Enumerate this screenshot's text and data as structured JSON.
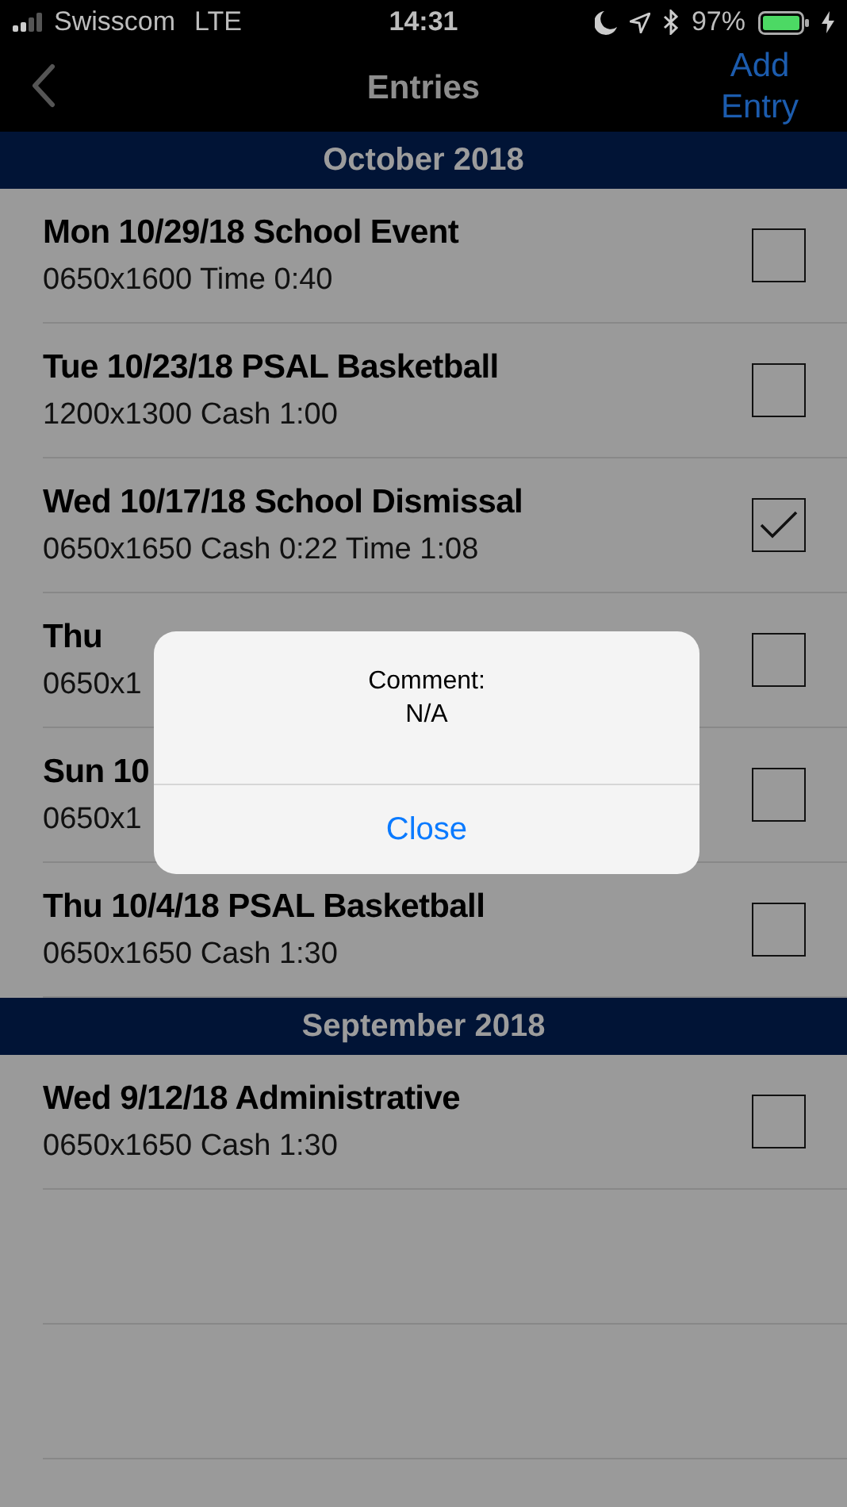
{
  "status_bar": {
    "carrier": "Swisscom",
    "network": "LTE",
    "time": "14:31",
    "battery": "97%"
  },
  "nav": {
    "title": "Entries",
    "action": "Add Entry"
  },
  "sections": [
    {
      "title": "October 2018",
      "entries": [
        {
          "title": "Mon 10/29/18 School Event",
          "detail": "0650x1600 Time 0:40",
          "checked": false
        },
        {
          "title": "Tue 10/23/18 PSAL Basketball",
          "detail": "1200x1300 Cash 1:00",
          "checked": false
        },
        {
          "title": "Wed 10/17/18 School Dismissal",
          "detail": "0650x1650 Cash 0:22 Time 1:08",
          "checked": true
        },
        {
          "title": "Thu",
          "detail": "0650x1",
          "checked": false
        },
        {
          "title": "Sun 10",
          "detail": "0650x1",
          "checked": false
        },
        {
          "title": "Thu 10/4/18 PSAL Basketball",
          "detail": "0650x1650 Cash 1:30",
          "checked": false
        }
      ]
    },
    {
      "title": "September 2018",
      "entries": [
        {
          "title": "Wed 9/12/18 Administrative",
          "detail": "0650x1650 Cash 1:30",
          "checked": false
        }
      ]
    }
  ],
  "alert": {
    "title": "Comment:",
    "message": "N/A",
    "button": "Close"
  }
}
